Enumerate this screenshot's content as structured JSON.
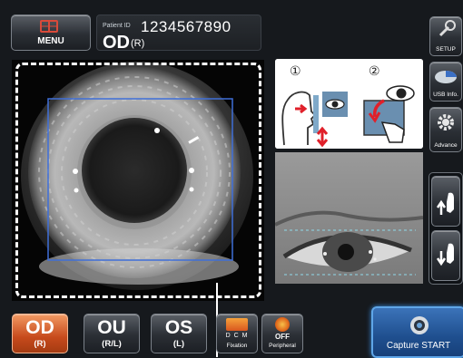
{
  "header": {
    "menu_label": "MENU",
    "patient_id_label": "Patient ID",
    "patient_id": "1234567890",
    "eye_title": "OD",
    "eye_sub": "(R)"
  },
  "guide": {
    "step1": "①",
    "step2": "②"
  },
  "right_buttons": {
    "setup": "SETUP",
    "usb": "USB Info.",
    "advance": "Advance"
  },
  "bottom": {
    "od_big": "OD",
    "od_small": "(R)",
    "ou_big": "OU",
    "ou_small": "(R/L)",
    "os_big": "OS",
    "os_small": "(L)",
    "fixation_label": "Fixation",
    "fixation_top": "D C M",
    "peripheral_label": "Peripheral",
    "peripheral_top": "OFF",
    "capture_label": "Capture START"
  },
  "colors": {
    "accent_orange": "#d9571f",
    "capture_blue": "#2b63a8",
    "alignment_box": "#3f6fd8"
  },
  "icons": [
    "menu-icon",
    "setup-icon",
    "usb-icon",
    "advance-gear-icon",
    "move-up-icon",
    "move-down-icon",
    "camera-icon"
  ]
}
